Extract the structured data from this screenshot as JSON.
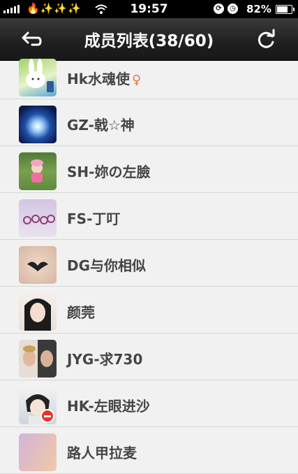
{
  "status": {
    "time": "19:57",
    "battery": "82%",
    "battery_level": 0.82,
    "emoji": "🔥✨✨✨"
  },
  "header": {
    "title": "成员列表(38/60)"
  },
  "members": [
    {
      "name": "Hk水魂使",
      "gender_icon": "♀"
    },
    {
      "name": "GZ-戟☆神"
    },
    {
      "name": "SH-妳の左臉"
    },
    {
      "name": "FS-丁叮"
    },
    {
      "name": "DG与你相似"
    },
    {
      "name": "颜莞"
    },
    {
      "name": "JYG-求730"
    },
    {
      "name": "HK-左眼进沙"
    },
    {
      "name": "路人甲拉麦"
    }
  ],
  "colors": {
    "navbar": "#1f1f1f",
    "list_bg": "#f1f1f1",
    "name_text": "#454545",
    "badge": "#e8322b"
  }
}
